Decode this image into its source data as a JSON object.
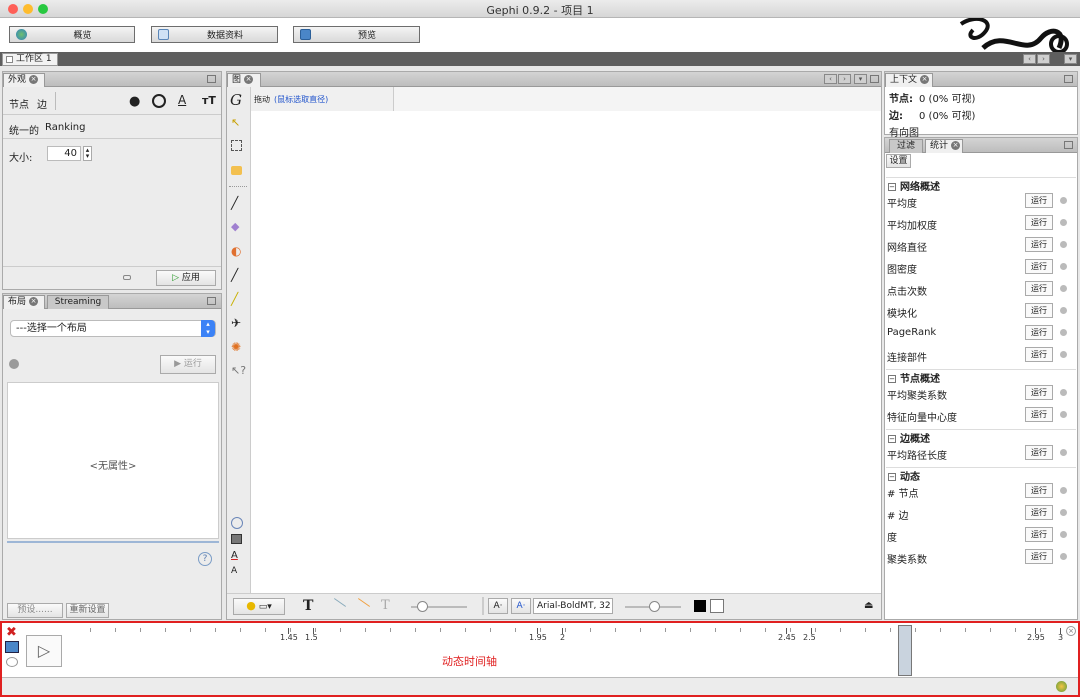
{
  "window": {
    "title": "Gephi 0.9.2 - 项目 1"
  },
  "modes": {
    "overview": "概览",
    "data": "数据资料",
    "preview": "预览"
  },
  "workspace": {
    "tab": "工作区 1"
  },
  "appearance": {
    "tab": "外观",
    "node": "节点",
    "edge": "边",
    "unique": "统一的",
    "ranking": "Ranking",
    "size_label": "大小:",
    "size_value": "40",
    "apply": "应用"
  },
  "layout": {
    "tab": "布局",
    "streaming": "Streaming",
    "select": "---选择一个布局",
    "run": "运行",
    "no_props": "<无属性>",
    "preset": "预设......",
    "reset": "重新设置",
    "help": "?"
  },
  "graph": {
    "tab": "图",
    "drag": "拖动",
    "drag_hint": "(鼠标选取直径)",
    "font": "Arial-BoldMT, 32"
  },
  "context": {
    "tab": "上下文",
    "nodes_label": "节点:",
    "nodes_value": "0 (0% 可视)",
    "edges_label": "边:",
    "edges_value": "0 (0% 可视)",
    "type": "有向图"
  },
  "stats": {
    "filter_tab": "过滤",
    "stats_tab": "统计",
    "settings": "设置",
    "run": "运行",
    "sections": [
      {
        "title": "网络概述",
        "items": [
          "平均度",
          "平均加权度",
          "网络直径",
          "图密度",
          "点击次数",
          "模块化",
          "PageRank",
          "连接部件"
        ]
      },
      {
        "title": "节点概述",
        "items": [
          "平均聚类系数",
          "特征向量中心度"
        ]
      },
      {
        "title": "边概述",
        "items": [
          "平均路径长度"
        ]
      },
      {
        "title": "动态",
        "items": [
          "# 节点",
          "# 边",
          "度",
          "聚类系数"
        ]
      }
    ]
  },
  "timeline": {
    "annotation": "动态时间轴",
    "annotation_color": "#e02020",
    "ticks": [
      "1.45",
      "1.5",
      "1.95",
      "2",
      "2.45",
      "2.5",
      "2.95",
      "3"
    ]
  }
}
